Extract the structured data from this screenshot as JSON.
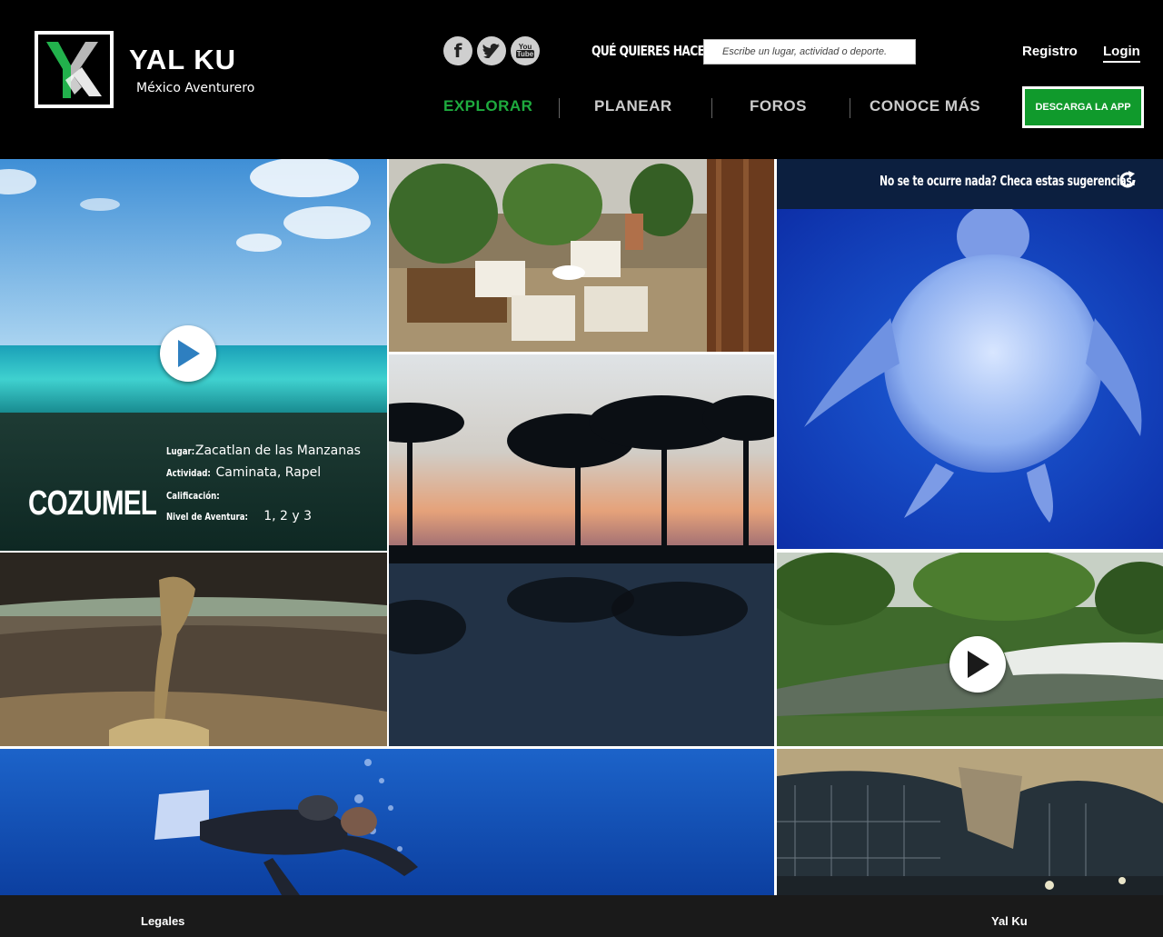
{
  "brand": {
    "name": "YAL KU",
    "tagline": "México Aventurero"
  },
  "social": [
    {
      "name": "facebook",
      "glyph": "f"
    },
    {
      "name": "twitter",
      "glyph": "t"
    },
    {
      "name": "youtube",
      "glyph_top": "You",
      "glyph_bottom": "Tube"
    }
  ],
  "search": {
    "question": "QUÉ QUIERES HACER?",
    "placeholder": "Escribe un lugar, actividad o deporte."
  },
  "auth": {
    "register": "Registro",
    "login": "Login"
  },
  "nav": {
    "items": [
      {
        "label": "EXPLORAR",
        "active": true
      },
      {
        "label": "PLANEAR",
        "active": false
      },
      {
        "label": "FOROS",
        "active": false
      },
      {
        "label": "CONOCE MÁS",
        "active": false
      }
    ],
    "app_button": "DESCARGA LA APP"
  },
  "featured": {
    "name": "COZUMEL",
    "lugar_label": "Lugar:",
    "lugar": "Zacatlan de las Manzanas",
    "actividad_label": "Actividad:",
    "actividad": "Caminata, Rapel",
    "calificacion_label": "Calificación:",
    "calificacion": "",
    "nivel_label": "Nivel de Aventura:",
    "nivel": "1, 2 y 3"
  },
  "suggestions": {
    "text": "No se te ocurre nada?  Checa estas sugerencias."
  },
  "tiles": [
    {
      "name": "caribbean-sea",
      "has_video": true
    },
    {
      "name": "hotel-terrace",
      "has_video": false
    },
    {
      "name": "sea-turtle",
      "has_video": false
    },
    {
      "name": "palm-sunset",
      "has_video": false
    },
    {
      "name": "bronze-sculpture",
      "has_video": false
    },
    {
      "name": "river-forest",
      "has_video": true
    },
    {
      "name": "scuba-diver",
      "has_video": false
    },
    {
      "name": "arch-structure",
      "has_video": false
    }
  ],
  "footer": {
    "legal": "Legales",
    "company": "Yal Ku"
  },
  "colors": {
    "accent_green": "#1eab3e",
    "header_bg": "#000000",
    "footer_bg": "#1a1a1a",
    "suggest_bar": "#0c1f3f"
  }
}
